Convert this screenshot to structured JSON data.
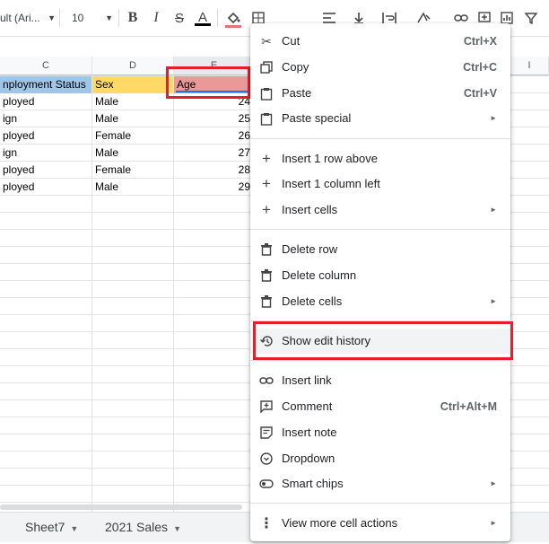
{
  "toolbar": {
    "font_name": "ult (Ari...",
    "font_size": "10",
    "bold": "B",
    "italic": "I",
    "strike": "S",
    "text_color": "A",
    "text_color_value": "#000000",
    "fill_color_value": "#e57373"
  },
  "columns": [
    {
      "id": "c",
      "label": "C"
    },
    {
      "id": "d",
      "label": "D"
    },
    {
      "id": "e",
      "label": "E"
    },
    {
      "id": "i",
      "label": "I"
    }
  ],
  "header_row": {
    "c": "nployment Status",
    "d": "Sex",
    "e": "Age"
  },
  "rows": [
    {
      "c": "ployed",
      "d": "Male",
      "e": "24"
    },
    {
      "c": "ign",
      "d": "Male",
      "e": "25"
    },
    {
      "c": "ployed",
      "d": "Female",
      "e": "26"
    },
    {
      "c": "ign",
      "d": "Male",
      "e": "27"
    },
    {
      "c": "ployed",
      "d": "Female",
      "e": "28"
    },
    {
      "c": "ployed",
      "d": "Male",
      "e": "29"
    }
  ],
  "sheet_tabs": [
    {
      "label": "Sheet7"
    },
    {
      "label": "2021 Sales"
    }
  ],
  "context_menu": {
    "items": [
      {
        "label": "Cut",
        "shortcut": "Ctrl+X",
        "icon": "scissors-icon"
      },
      {
        "label": "Copy",
        "shortcut": "Ctrl+C",
        "icon": "copy-icon"
      },
      {
        "label": "Paste",
        "shortcut": "Ctrl+V",
        "icon": "clipboard-icon"
      },
      {
        "label": "Paste special",
        "shortcut": "",
        "icon": "clipboard-icon",
        "submenu": true
      },
      {
        "label": "Insert 1 row above",
        "icon": "plus-icon"
      },
      {
        "label": "Insert 1 column left",
        "icon": "plus-icon"
      },
      {
        "label": "Insert cells",
        "icon": "plus-icon",
        "submenu": true
      },
      {
        "label": "Delete row",
        "icon": "trash-icon"
      },
      {
        "label": "Delete column",
        "icon": "trash-icon"
      },
      {
        "label": "Delete cells",
        "icon": "trash-icon",
        "submenu": true
      },
      {
        "label": "Show edit history",
        "icon": "history-icon",
        "highlighted": true
      },
      {
        "label": "Insert link",
        "icon": "link-icon"
      },
      {
        "label": "Comment",
        "shortcut": "Ctrl+Alt+M",
        "icon": "comment-icon"
      },
      {
        "label": "Insert note",
        "icon": "note-icon"
      },
      {
        "label": "Dropdown",
        "icon": "dropdown-icon"
      },
      {
        "label": "Smart chips",
        "icon": "chip-icon",
        "submenu": true
      },
      {
        "label": "View more cell actions",
        "icon": "more-vert-icon",
        "submenu": true
      }
    ]
  },
  "colors": {
    "header_c": "#9fc5e8",
    "header_d": "#ffd966",
    "header_e": "#ea9999",
    "highlight_box": "#e0202a"
  }
}
